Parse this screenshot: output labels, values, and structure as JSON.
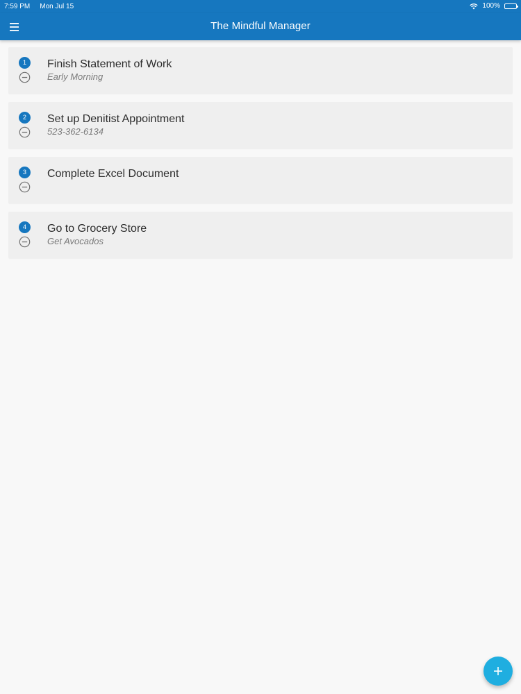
{
  "status_bar": {
    "time": "7:59 PM",
    "date": "Mon Jul 15",
    "battery": "100%"
  },
  "app_bar": {
    "title": "The Mindful Manager",
    "menu_icon": "hamburger-menu-icon"
  },
  "tasks": [
    {
      "number": "1",
      "title": "Finish Statement of Work",
      "note": "Early Morning"
    },
    {
      "number": "2",
      "title": "Set up Denitist Appointment",
      "note": "523-362-6134"
    },
    {
      "number": "3",
      "title": "Complete Excel Document",
      "note": ""
    },
    {
      "number": "4",
      "title": "Go to Grocery Store",
      "note": "Get Avocados"
    }
  ],
  "fab": {
    "icon": "plus-icon"
  },
  "colors": {
    "primary": "#1677bf",
    "fab": "#1faee0",
    "card": "#efefef",
    "background": "#f8f8f8"
  }
}
